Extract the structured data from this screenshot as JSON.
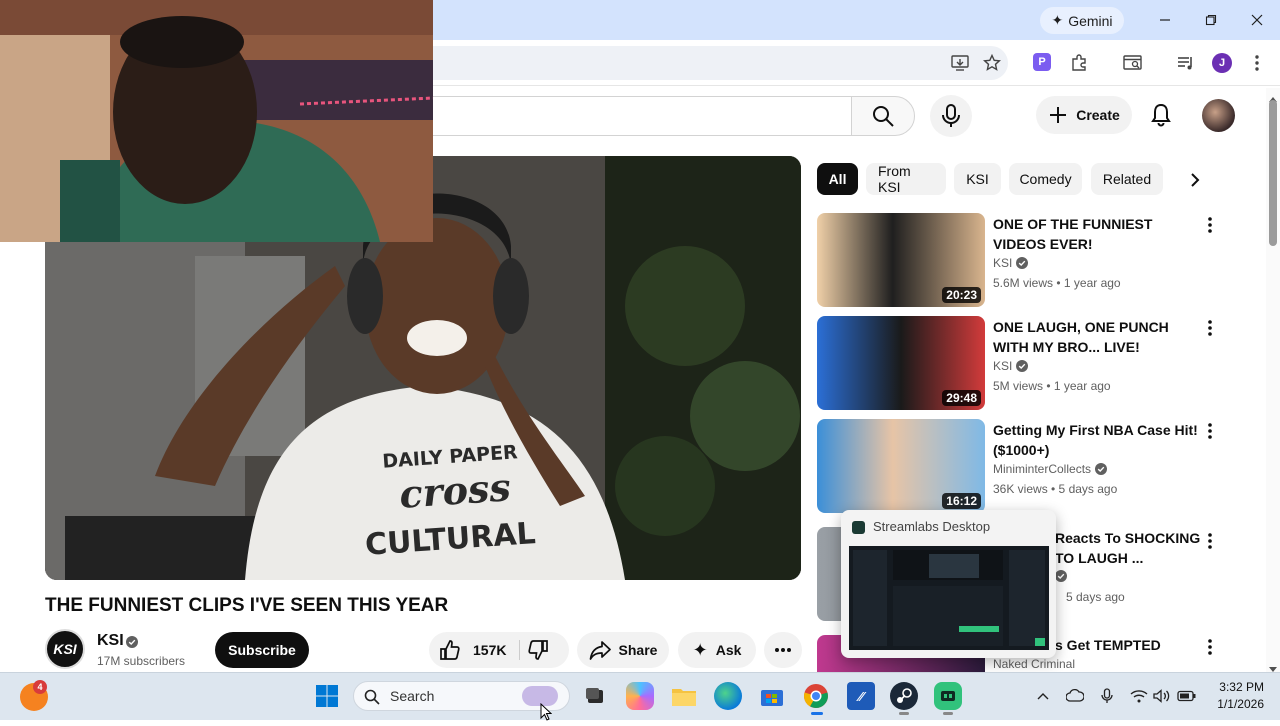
{
  "browser": {
    "gemini_label": "Gemini",
    "profile_initial": "J",
    "extension_letter": "P"
  },
  "masthead": {
    "create_label": "Create"
  },
  "video": {
    "title": "THE FUNNIEST CLIPS I'VE SEEN THIS YEAR",
    "channel": "KSI",
    "channel_avatar_text": "KSI",
    "subscribers": "17M subscribers",
    "subscribe_label": "Subscribe",
    "likes": "157K",
    "share_label": "Share",
    "ask_label": "Ask",
    "shirt_text_1": "DAILY PAPER",
    "shirt_text_2": "cross",
    "shirt_text_3": "CULTURAL"
  },
  "chips": [
    "All",
    "From KSI",
    "KSI",
    "Comedy",
    "Related"
  ],
  "recommendations": [
    {
      "title": "ONE OF THE FUNNIEST VIDEOS EVER!",
      "channel": "KSI",
      "verified": true,
      "meta": "5.6M views • 1 year ago",
      "duration": "20:23",
      "thumb_color": "#e8c9a0"
    },
    {
      "title": "ONE LAUGH, ONE PUNCH WITH MY BRO... LIVE!",
      "channel": "KSI",
      "verified": true,
      "meta": "5M views • 1 year ago",
      "duration": "29:48",
      "thumb_color": "#2b6fd6"
    },
    {
      "title": "Getting My First NBA Case Hit! ($1000+)",
      "channel": "MiniminterCollects",
      "verified": true,
      "meta": "36K views • 5 days ago",
      "duration": "16:12",
      "thumb_color": "#4aa3e0"
    },
    {
      "title": "Reacts To SHOCKING TO LAUGH ...",
      "channel": "",
      "verified": true,
      "meta": "5 days ago",
      "duration": "",
      "thumb_color": "#8a8f96"
    },
    {
      "title": "s Get TEMPTED",
      "channel": "Naked Criminal",
      "verified": false,
      "meta": "",
      "duration": "",
      "thumb_color": "#b03a8a"
    }
  ],
  "popup": {
    "title": "Streamlabs Desktop"
  },
  "taskbar": {
    "search_label": "Search",
    "notification_count": "4",
    "time": "3:32 PM",
    "date": "1/1/2026"
  }
}
